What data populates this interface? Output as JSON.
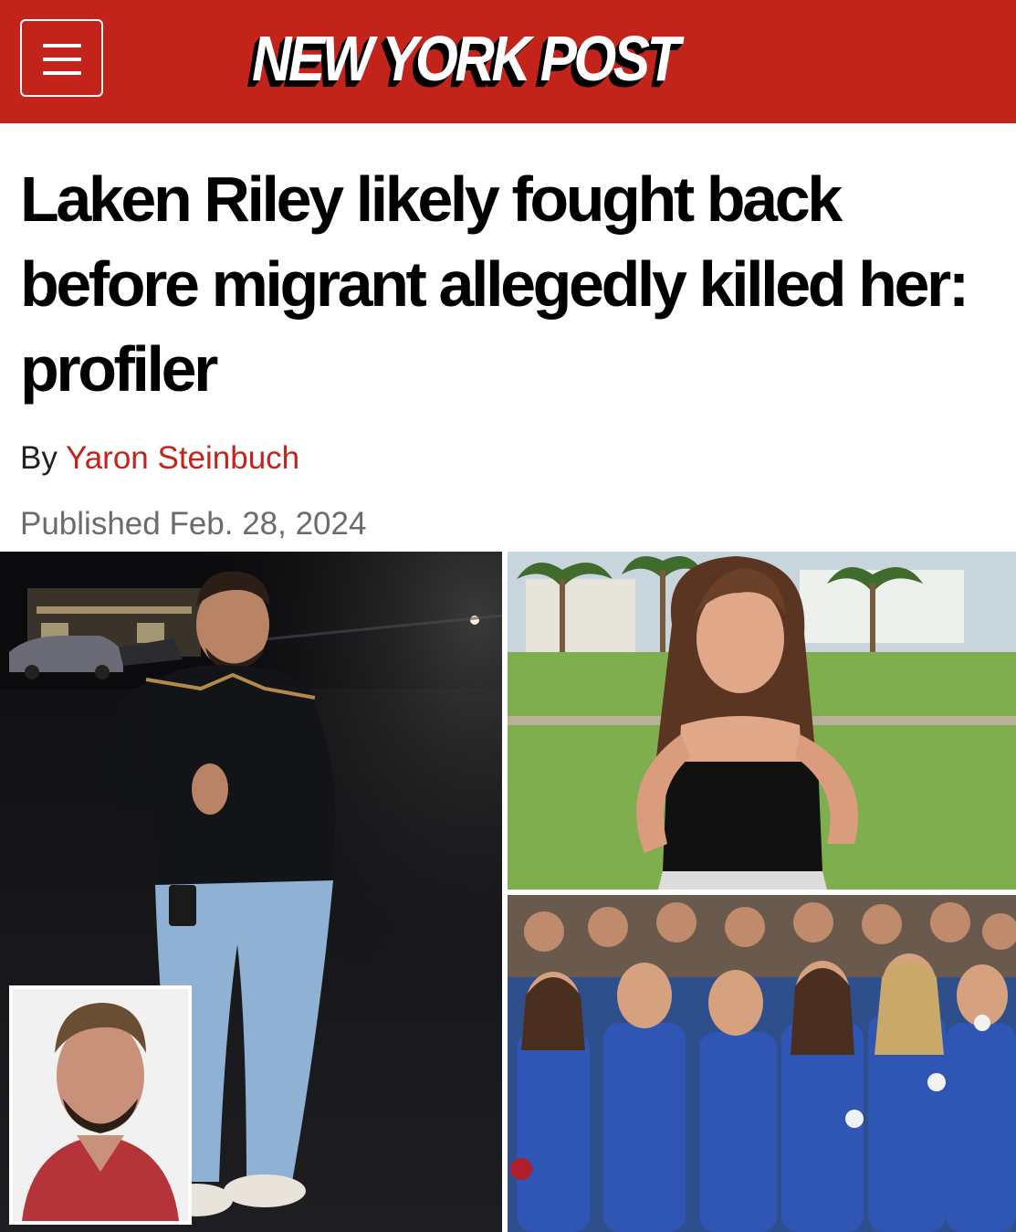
{
  "header": {
    "brand": "NEW YORK POST",
    "brand_color": "#c2231a",
    "menu_icon": "hamburger-menu-icon"
  },
  "article": {
    "headline": "Laken Riley likely fought back before migrant allegedly killed her: profiler",
    "byline_prefix": "By",
    "author": "Yaron Steinbuch",
    "published": "Published Feb. 28, 2024"
  }
}
